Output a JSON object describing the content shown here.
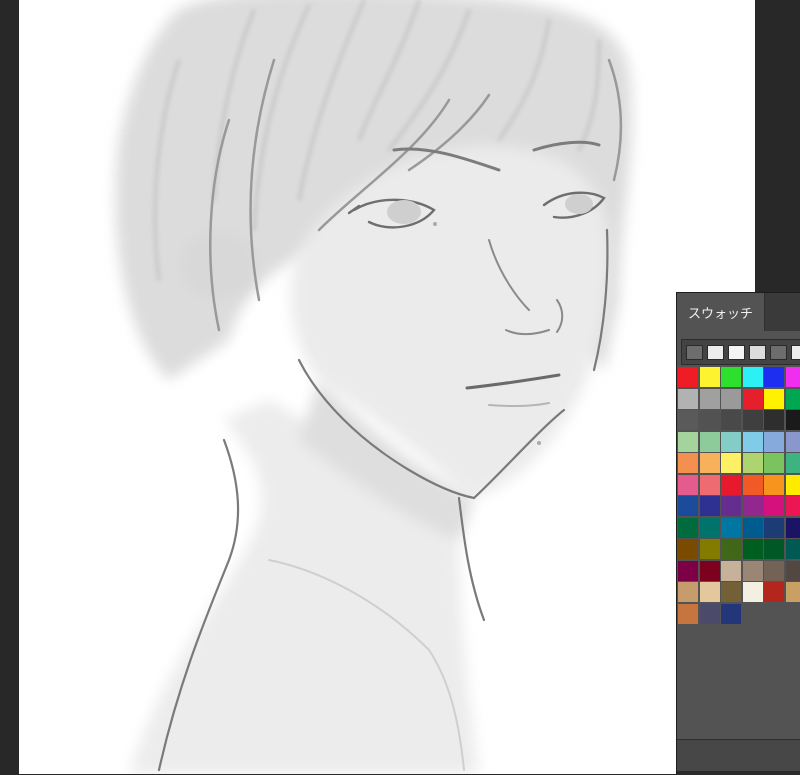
{
  "swatches_panel": {
    "tab_label": "スウォッチ",
    "recent_colors": [
      "#6d6d6d",
      "#ececec",
      "#f4f4f4",
      "#dcdcdc",
      "#6d6d6d",
      "#ececec"
    ],
    "rows": [
      [
        "#ef1c25",
        "#fdf32f",
        "#2ee02e",
        "#2cf0f4",
        "#1d2ef1",
        "#f02ef0"
      ],
      [
        "#b2b2b2",
        "#a0a0a0",
        "#9a9a9a",
        "#e61f2d",
        "#fff100",
        "#00a650"
      ],
      [
        "#5a5a5a",
        "#525252",
        "#494949",
        "#3f3f3f",
        "#2e2e2e",
        "#1a1a1a"
      ],
      [
        "#a4d49b",
        "#8dcc9a",
        "#84cdc6",
        "#80cbe8",
        "#86aadb",
        "#8a97cc"
      ],
      [
        "#f3904f",
        "#f6b15a",
        "#fdf065",
        "#add46e",
        "#7ac35f",
        "#3db480"
      ],
      [
        "#e65b8e",
        "#ef6b72",
        "#e8192c",
        "#f15a24",
        "#f7941d",
        "#ffeb00"
      ],
      [
        "#1c4b9c",
        "#2e3192",
        "#662d91",
        "#92278f",
        "#d4117c",
        "#ec1654"
      ],
      [
        "#006b3c",
        "#00736b",
        "#0076a3",
        "#005b8e",
        "#1d3b75",
        "#1b1464"
      ],
      [
        "#7a4a00",
        "#827b00",
        "#406618",
        "#005e20",
        "#005826",
        "#005952"
      ],
      [
        "#7b0046",
        "#7d001f",
        "#c7b299",
        "#998675",
        "#736357",
        "#534741"
      ],
      [
        "#c69c6d",
        "#e3c89e",
        "#736037",
        "#f4f0e1",
        "#b3261e",
        "#c9a064"
      ],
      [
        "#c7753f",
        "#4b4a6b",
        "#24367a"
      ]
    ]
  }
}
